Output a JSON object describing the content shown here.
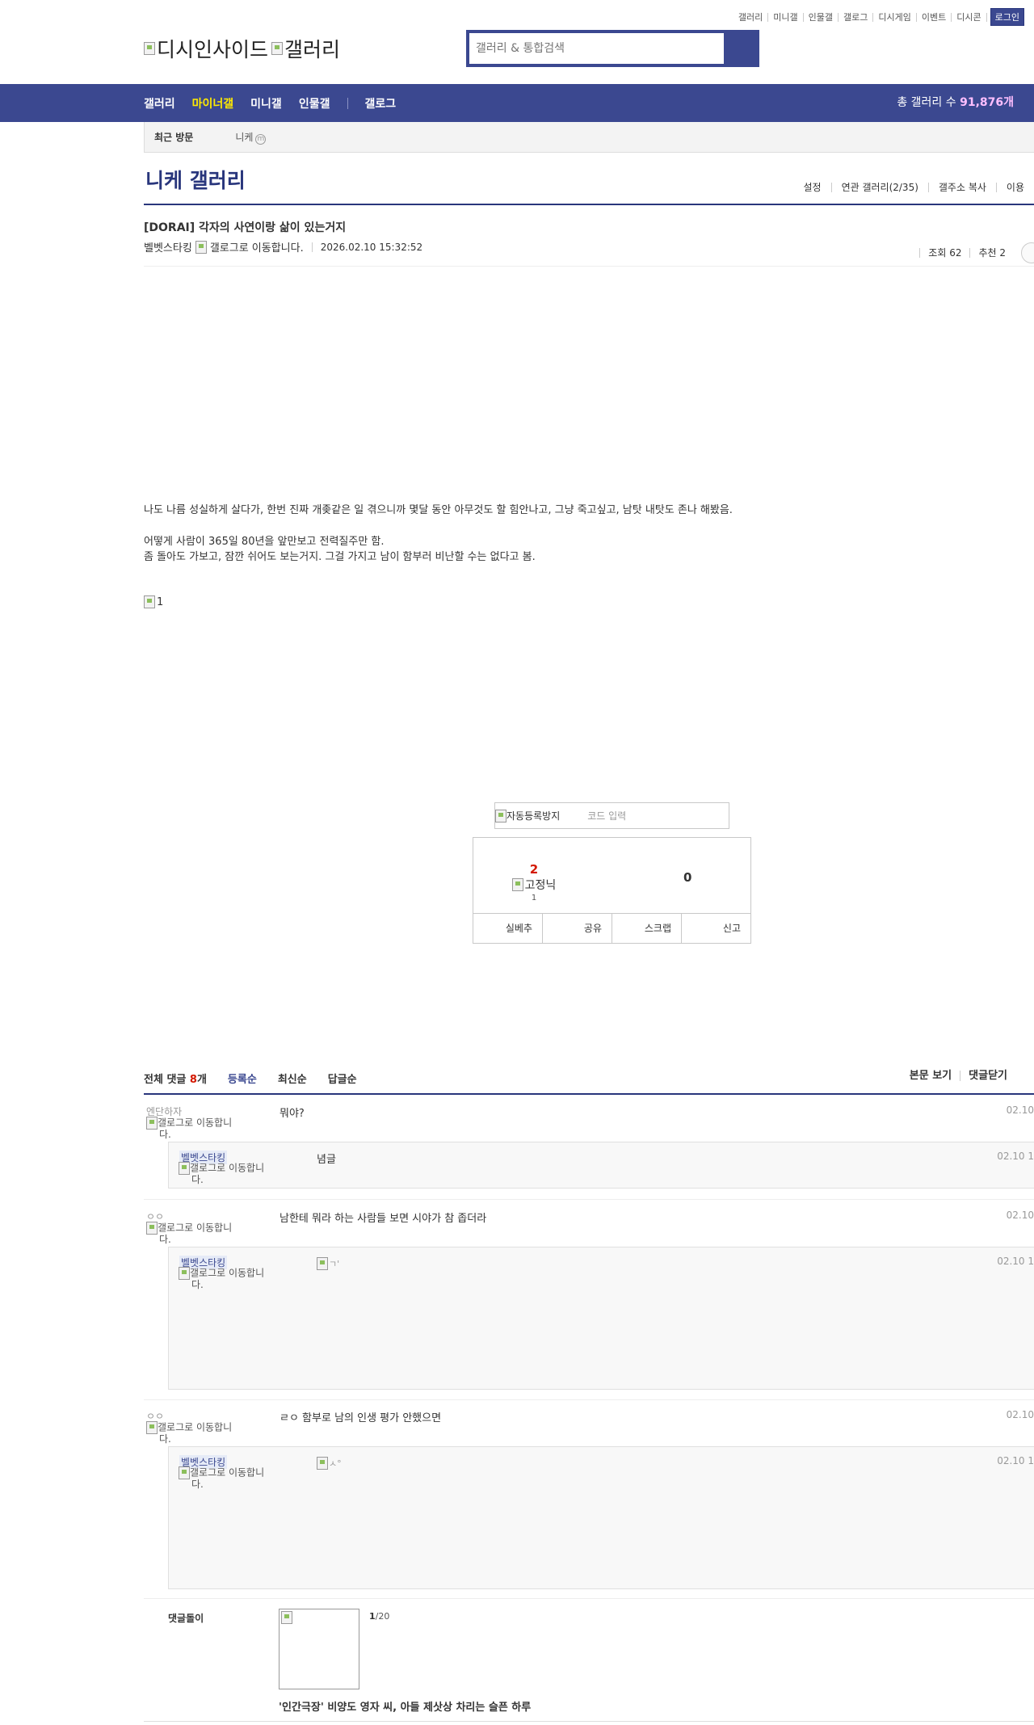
{
  "util": {
    "links": [
      "갤러리",
      "미니갤",
      "인물갤",
      "갤로그",
      "디시게임",
      "이벤트",
      "디시콘"
    ],
    "login": "로그인"
  },
  "header": {
    "brand_alt": "디시인사이드",
    "gallery_alt": "갤러리",
    "search_placeholder": "갤러리 & 통합검색"
  },
  "nav": {
    "items": [
      "갤러리",
      "마이너갤",
      "미니갤",
      "인물갤"
    ],
    "gallog": "갤로그",
    "total_label": "총 갤러리 수 ",
    "total_value": "91,876개"
  },
  "recent": {
    "label": "최근 방문",
    "gallery": "니케",
    "close": "m"
  },
  "gallery": {
    "title": "니케 갤러리",
    "tools": [
      "설정",
      "연관 갤러리(2/35)",
      "갤주소 복사",
      "이용"
    ]
  },
  "post": {
    "title": "[DORAI] 각자의 사연이랑 삶이 있는거지",
    "author": "벨벳스타킹",
    "gallog_alt": "갤로그로 이동합니다.",
    "date": "2026.02.10 15:32:52",
    "views": "조회 62",
    "recommend": "추천 2",
    "body": [
      "나도 나름 성실하게 살다가, 한번 진짜 개좆같은 일 겪으니까 몇달 동안 아무것도 할 힘안나고, 그냥 죽고싶고, 남탓 내탓도 존나 해봤음.",
      "어떻게 사람이 365일 80년을 앞만보고 전력질주만 함.",
      "좀 돌아도 가보고, 잠깐 쉬어도 보는거지. 그걸 가지고 남이  함부러 비난할 수는 없다고 봄."
    ],
    "image_alt": "1"
  },
  "captcha": {
    "img_alt": "자동등록방지",
    "placeholder": "코드 입력"
  },
  "vote": {
    "up_count": "2",
    "nick_alt": "고정닉",
    "fixed_count": "1",
    "down_count": "0",
    "buttons": [
      "실베추",
      "공유",
      "스크랩",
      "신고"
    ]
  },
  "comments_head": {
    "total_prefix": "전체 댓글 ",
    "total_count": "8",
    "total_suffix": "개",
    "sorts": [
      "등록순",
      "최신순",
      "답글순"
    ],
    "right": [
      "본문 보기",
      "댓글닫기",
      ""
    ]
  },
  "comments": [
    {
      "nick": "엔단하자",
      "gallog_l1": "갤로그로 이동합니",
      "gallog_l2": "다.",
      "text": "뭐야?",
      "date": "02.10",
      "reply": {
        "nick": "벨벳스타킹",
        "gallog_l1": "갤로그로 이동합니",
        "gallog_l2": "다.",
        "text": "념글",
        "date": "02.10 1"
      }
    },
    {
      "nick": "ㅇㅇ",
      "gallog_l1": "갤로그로 이동합니",
      "gallog_l2": "다.",
      "text": "남한테 뭐라 하는 사람들 보면 시야가 참 좁더라",
      "date": "02.10",
      "reply": {
        "nick": "벨벳스타킹",
        "gallog_l1": "갤로그로 이동합니",
        "gallog_l2": "다.",
        "dccon_alt": "ㄱ'",
        "date": "02.10 1"
      }
    },
    {
      "nick": "ㅇㅇ",
      "gallog_l1": "갤로그로 이동합니",
      "gallog_l2": "다.",
      "text": "ㄹㅇ 함부로 남의 인생 평가 안했으면",
      "date": "02.10",
      "reply": {
        "nick": "벨벳스타킹",
        "gallog_l1": "갤로그로 이동합니",
        "gallog_l2": "다.",
        "dccon_alt": "ㅅ°",
        "date": "02.10 1"
      }
    }
  ],
  "dcbot": {
    "label": "댓글돌이",
    "page_current": "1",
    "page_total": "/20",
    "caption": "'인간극장' 비양도 영자 씨, 아들 제삿상 차리는 슬픈 하루"
  }
}
